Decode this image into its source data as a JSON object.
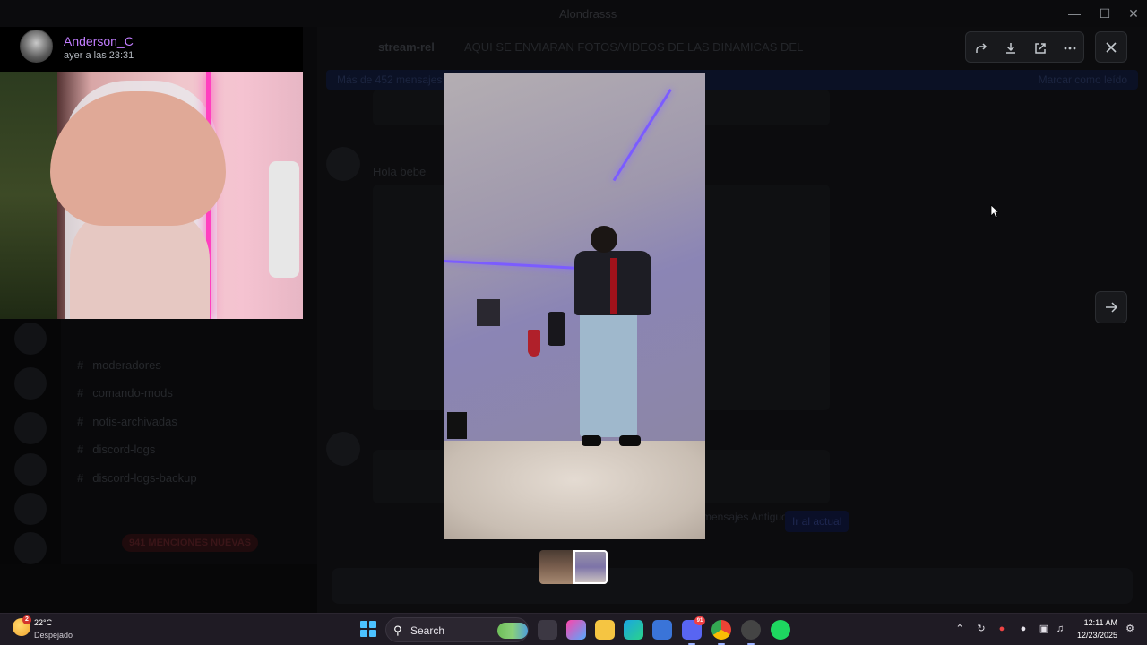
{
  "window": {
    "title": "Alondrasss"
  },
  "stream": {
    "user_name": "Anderson_C",
    "timestamp": "ayer a las 23:31"
  },
  "channels": [
    {
      "name": "moderadores"
    },
    {
      "name": "comando-mods"
    },
    {
      "name": "notis-archivadas"
    },
    {
      "name": "discord-logs"
    },
    {
      "name": "discord-logs-backup"
    }
  ],
  "channel_list": {
    "mentions_pill": "941 MENCIONES NUEVAS"
  },
  "chat": {
    "channel_name": "stream-rel",
    "topic": "AQUI SE ENVIARAN FOTOS/VIDEOS DE LAS DINAMICAS DEL",
    "new_messages_label": "Más de 452 mensajes",
    "mark_read_label": "Marcar como leído",
    "message_preview": "Hola bebe",
    "jump_label": "mensajes Antiguos",
    "jump_button": "Ir al actual"
  },
  "viewer": {
    "toolbar": {
      "forward_icon": "forward-icon",
      "download_icon": "download-icon",
      "open_external_icon": "open-external-icon",
      "more_icon": "more-icon"
    },
    "close_icon": "close-icon",
    "next_icon": "arrow-right-icon",
    "thumbnail_count": 2,
    "selected_thumbnail": 2
  },
  "taskbar": {
    "weather_temp": "22°C",
    "weather_desc": "Despejado",
    "weather_badge": "2",
    "search_placeholder": "Search",
    "discord_badge": "91",
    "clock_time": "12:11 AM",
    "clock_date": "12/23/2025"
  },
  "colors": {
    "username": "#c27dff",
    "accent": "#4cc2ff",
    "notification": "#f23f42"
  }
}
